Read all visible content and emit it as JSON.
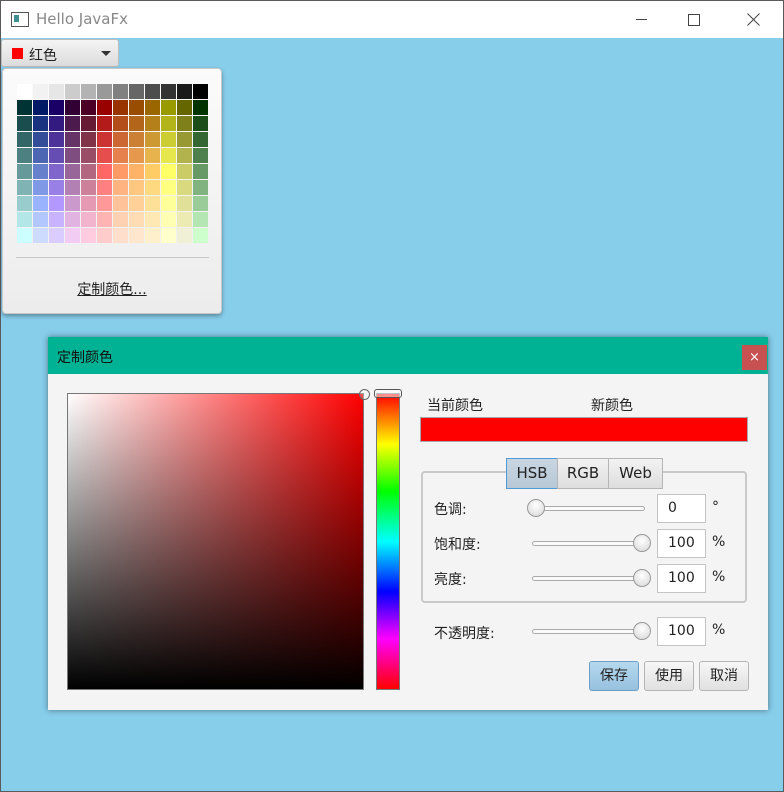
{
  "window": {
    "title": "Hello JavaFx"
  },
  "color_picker": {
    "selected_label": "红色",
    "selected_color": "#ff0000"
  },
  "palette": {
    "rows": [
      [
        "#ffffff",
        "#f2f2f2",
        "#e6e6e6",
        "#cccccc",
        "#b3b3b3",
        "#999999",
        "#808080",
        "#666666",
        "#4d4d4d",
        "#333333",
        "#1a1a1a",
        "#000000"
      ],
      [
        "#003333",
        "#001a66",
        "#1a0066",
        "#330033",
        "#4d0026",
        "#990000",
        "#993300",
        "#994d00",
        "#996600",
        "#999900",
        "#666600",
        "#003300"
      ],
      [
        "#1a4d4d",
        "#1a3380",
        "#331a80",
        "#4d1a4d",
        "#661a33",
        "#b31a1a",
        "#b34d1a",
        "#b3661a",
        "#b3801a",
        "#b3b31a",
        "#80801a",
        "#1a4d1a"
      ],
      [
        "#336666",
        "#334d99",
        "#4d3399",
        "#663366",
        "#803349",
        "#cc3333",
        "#cc6633",
        "#cc8033",
        "#cc9933",
        "#cccc33",
        "#999933",
        "#336633"
      ],
      [
        "#4d8080",
        "#4d66b3",
        "#664db3",
        "#804d80",
        "#994d66",
        "#e64d4d",
        "#e6804d",
        "#e6994d",
        "#e6b34d",
        "#e6e64d",
        "#b3b34d",
        "#4d804d"
      ],
      [
        "#669999",
        "#6680cc",
        "#8066cc",
        "#996699",
        "#b36680",
        "#ff6666",
        "#ff9966",
        "#ffb366",
        "#ffcc66",
        "#ffff66",
        "#cccc66",
        "#669966"
      ],
      [
        "#80b3b3",
        "#8099e6",
        "#9980e6",
        "#b380b3",
        "#cc8099",
        "#ff8080",
        "#ffb380",
        "#ffc780",
        "#ffd980",
        "#ffff80",
        "#d9d980",
        "#80b380"
      ],
      [
        "#99cccc",
        "#99b3ff",
        "#b399ff",
        "#cc99cc",
        "#e699b3",
        "#ff9999",
        "#ffc299",
        "#ffd199",
        "#ffe099",
        "#ffff99",
        "#e0e099",
        "#99cc99"
      ],
      [
        "#b3e6e6",
        "#b3c7ff",
        "#c7b3ff",
        "#e0b3e0",
        "#f2b3cc",
        "#ffb3b3",
        "#ffd1b3",
        "#ffdcb3",
        "#ffe8b3",
        "#ffffb3",
        "#ebebb3",
        "#b3e6b3"
      ],
      [
        "#ccffff",
        "#ccdbff",
        "#dbccff",
        "#f2ccf2",
        "#ffccdf",
        "#ffcccc",
        "#ffdfcc",
        "#ffe6cc",
        "#fff0cc",
        "#ffffcc",
        "#f0f0d6",
        "#ccffcc"
      ]
    ],
    "custom_link": "定制颜色..."
  },
  "dialog": {
    "title": "定制颜色",
    "close_glyph": "×",
    "current_label": "当前颜色",
    "new_label": "新颜色",
    "current_color": "#ff0000",
    "new_color": "#ff0000",
    "tabs": [
      "HSB",
      "RGB",
      "Web"
    ],
    "active_tab": "HSB",
    "hue": {
      "label": "色调:",
      "value": "0",
      "unit": "°"
    },
    "saturation": {
      "label": "饱和度:",
      "value": "100",
      "unit": "%"
    },
    "brightness": {
      "label": "亮度:",
      "value": "100",
      "unit": "%"
    },
    "opacity": {
      "label": "不透明度:",
      "value": "100",
      "unit": "%"
    },
    "buttons": {
      "save": "保存",
      "use": "使用",
      "cancel": "取消"
    }
  }
}
